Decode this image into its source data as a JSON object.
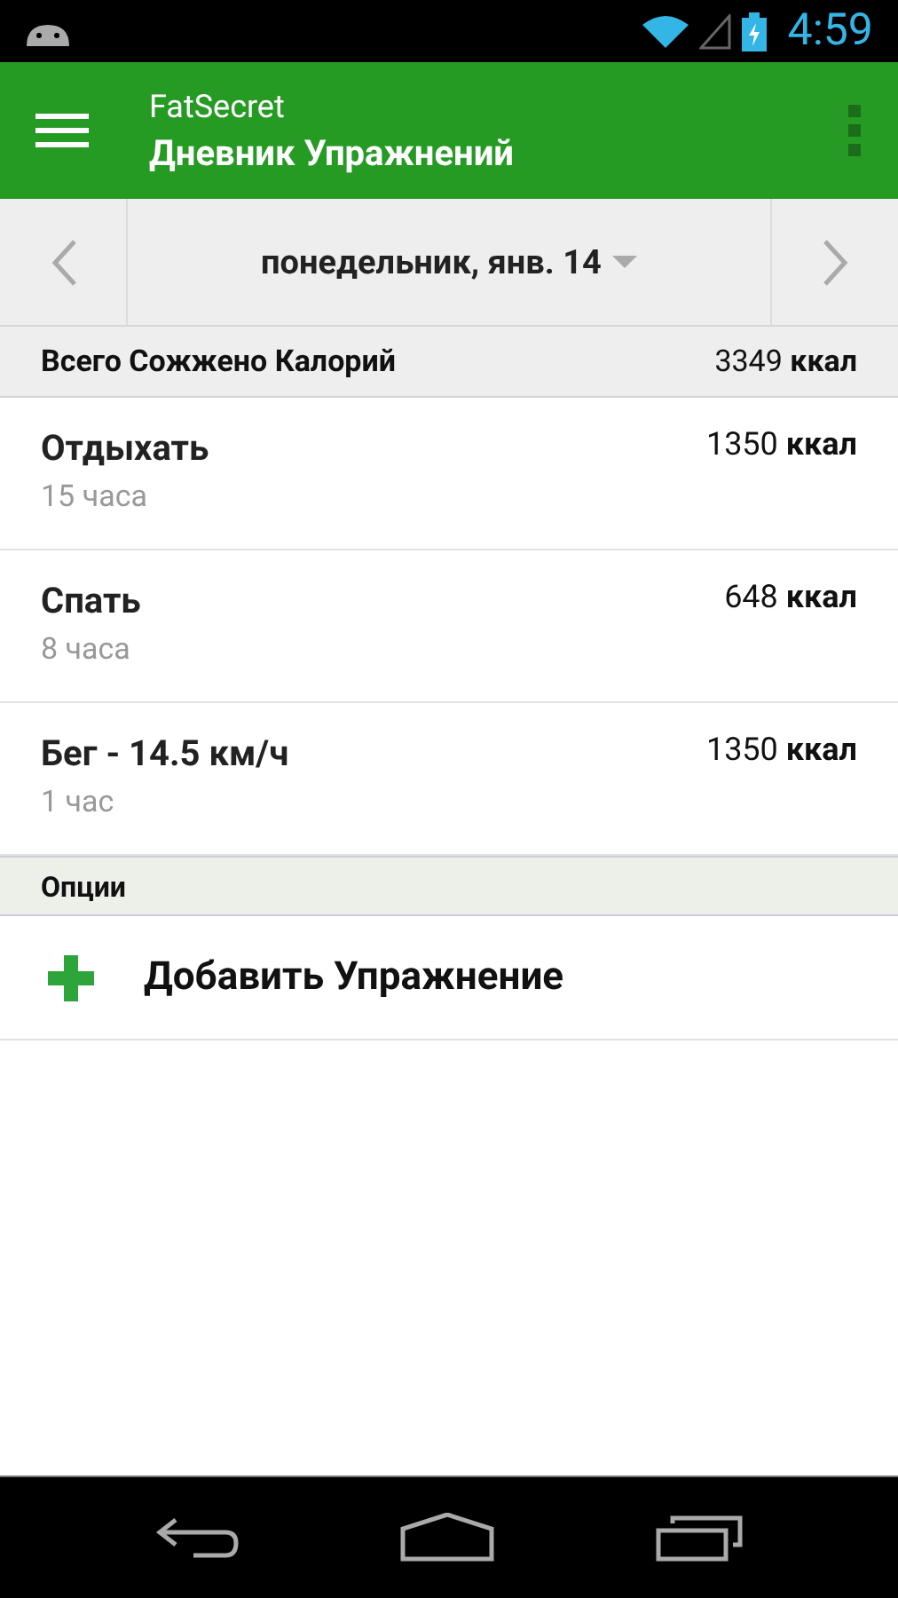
{
  "status_bar": {
    "time": "4:59"
  },
  "app_bar": {
    "app_name": "FatSecret",
    "title": "Дневник Упражнений"
  },
  "date_bar": {
    "date": "понедельник, янв. 14"
  },
  "total": {
    "label": "Всего Сожжено Калорий",
    "value": "3349 **ккал**"
  },
  "entries": [
    {
      "name": "Отдыхать",
      "duration": "15 часа",
      "calories": "1350 **ккал**"
    },
    {
      "name": "Спать",
      "duration": "8 часа",
      "calories": "648 **ккал**"
    },
    {
      "name": "Бег - 14.5 км/ч",
      "duration": "1 час",
      "calories": "1350 **ккал**"
    }
  ],
  "options": {
    "header": "Опции",
    "items": [
      {
        "label": "Добавить Упражнение"
      }
    ]
  }
}
